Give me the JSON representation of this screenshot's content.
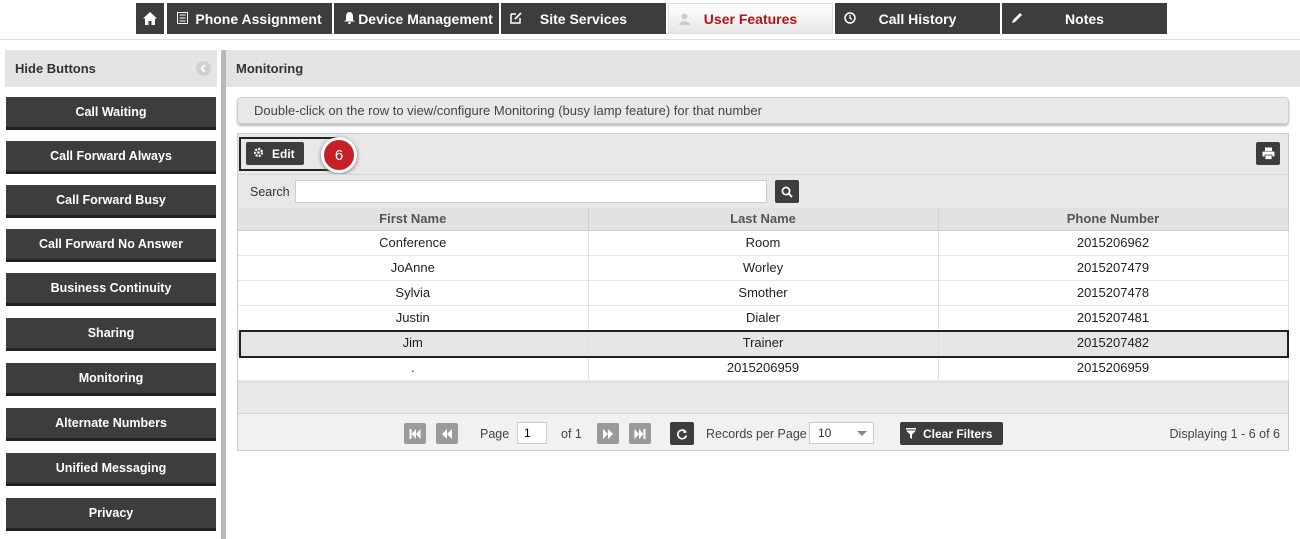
{
  "nav": {
    "tabs": [
      {
        "label": "",
        "icon": "home-icon"
      },
      {
        "label": "Phone Assignment",
        "icon": "list-icon"
      },
      {
        "label": "Device Management",
        "icon": "bell-icon"
      },
      {
        "label": "Site Services",
        "icon": "edit-icon"
      },
      {
        "label": "User Features",
        "icon": "user-icon",
        "active": true
      },
      {
        "label": "Call History",
        "icon": "clock-icon"
      },
      {
        "label": "Notes",
        "icon": "pencil-icon"
      }
    ]
  },
  "sidebar": {
    "title": "Hide Buttons",
    "items": [
      {
        "label": "Call Waiting"
      },
      {
        "label": "Call Forward Always"
      },
      {
        "label": "Call Forward Busy"
      },
      {
        "label": "Call Forward No Answer"
      },
      {
        "label": "Business Continuity"
      },
      {
        "label": "Sharing"
      },
      {
        "label": "Monitoring"
      },
      {
        "label": "Alternate Numbers"
      },
      {
        "label": "Unified Messaging"
      },
      {
        "label": "Privacy"
      }
    ]
  },
  "main": {
    "title": "Monitoring",
    "info": "Double-click on the row to view/configure Monitoring (busy lamp feature) for that number"
  },
  "toolbar": {
    "edit_label": "Edit",
    "step_number": "6"
  },
  "search": {
    "label": "Search",
    "value": "",
    "placeholder": ""
  },
  "table": {
    "columns": [
      "First Name",
      "Last Name",
      "Phone Number"
    ],
    "rows": [
      [
        "Conference",
        "Room",
        "2015206962"
      ],
      [
        "JoAnne",
        "Worley",
        "2015207479"
      ],
      [
        "Sylvia",
        "Smother",
        "2015207478"
      ],
      [
        "Justin",
        "Dialer",
        "2015207481"
      ],
      [
        "Jim",
        "Trainer",
        "2015207482"
      ],
      [
        ".",
        "2015206959",
        "2015206959"
      ]
    ],
    "selected_row": 4
  },
  "pager": {
    "page_label": "Page",
    "page_value": "1",
    "of_label": "of 1",
    "rpp_label": "Records per Page",
    "rpp_value": "10",
    "clear_label": "Clear Filters",
    "displaying": "Displaying 1 - 6 of 6"
  },
  "colors": {
    "button_dark": "#3d3d3d",
    "active_tab_text": "#b01515",
    "badge_red": "#c62026",
    "panel_header": "#e4e4e4"
  }
}
